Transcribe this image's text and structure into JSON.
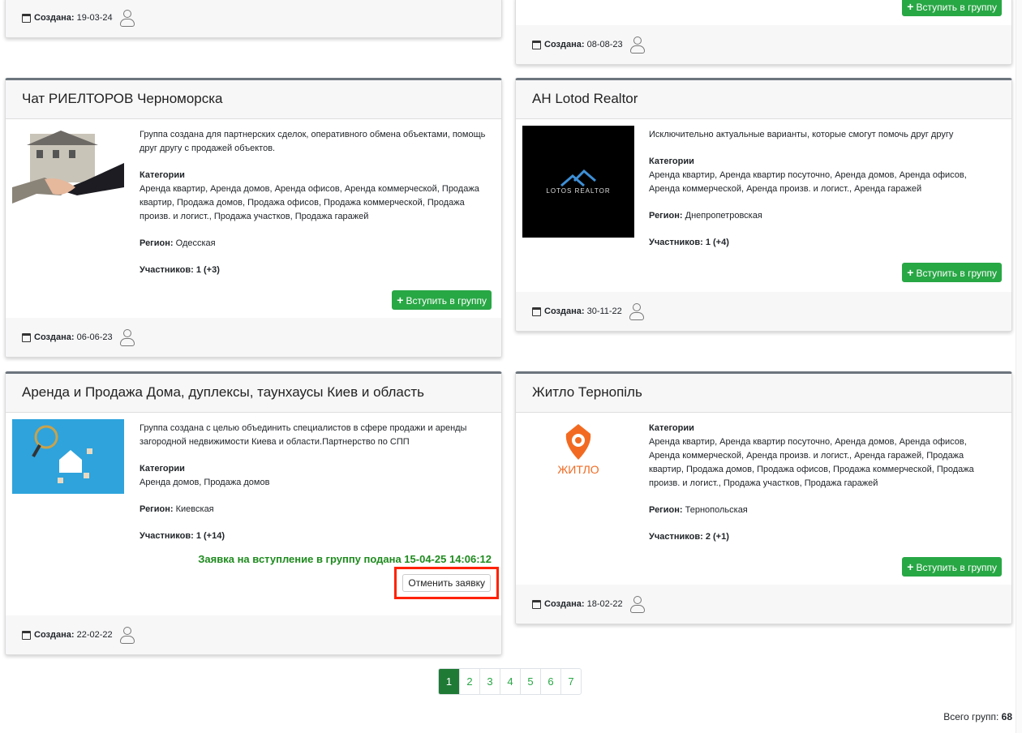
{
  "labels": {
    "categories": "Категории",
    "region": "Регион:",
    "members": "Участников:",
    "created": "Создана:",
    "join": "Вступить в группу",
    "join_plus": "+",
    "cancel": "Отменить заявку",
    "total_label": "Всего групп:"
  },
  "top_partial": {
    "left_created": "19-03-24",
    "right_created": "08-08-23"
  },
  "cards": [
    {
      "title": "Чат РИЕЛТОРОВ Черноморска",
      "description": "Группа создана для партнерских сделок, оперативного обмена объектами, помощь друг другу с продажей объектов.",
      "categories": "Аренда квартир, Аренда домов, Аренда офисов, Аренда коммерческой, Продажа квартир, Продажа домов, Продажа офисов, Продажа коммерческой, Продажа произв. и логист., Продажа участков, Продажа гаражей",
      "region": "Одесская",
      "members": "1 (+3)",
      "created": "06-06-23"
    },
    {
      "title": "АН Lotod Realtor",
      "description": "Исключительно актуальные варианты, которые смогут помочь друг другу",
      "categories": "Аренда квартир, Аренда квартир посуточно, Аренда домов, Аренда офисов, Аренда коммерческой, Аренда произв. и логист., Аренда гаражей",
      "region": "Днепропетровская",
      "members": "1 (+4)",
      "created": "30-11-22",
      "logo_text": "LOTOS REALTOR"
    },
    {
      "title": "Аренда и Продажа Дома, дуплексы, таунхаусы Киев и область",
      "description": "Группа создана с целью объединить специалистов в сфере продажи и аренды загородной недвижимости Киева и области.Партнерство по СПП",
      "categories": "Аренда домов, Продажа домов",
      "region": "Киевская",
      "members": "1 (+14)",
      "created": "22-02-22",
      "status": "Заявка на вступление в группу подана 15-04-25 14:06:12"
    },
    {
      "title": "Житло Тернопіль",
      "categories": "Аренда квартир, Аренда квартир посуточно, Аренда домов, Аренда офисов, Аренда коммерческой, Аренда произв. и логист., Аренда гаражей, Продажа квартир, Продажа домов, Продажа офисов, Продажа коммерческой, Продажа произв. и логист., Продажа участков, Продажа гаражей",
      "region": "Тернопольская",
      "members": "2 (+1)",
      "created": "18-02-22",
      "logo_text": "ЖИТЛО"
    }
  ],
  "pagination": {
    "pages": [
      "1",
      "2",
      "3",
      "4",
      "5",
      "6",
      "7"
    ],
    "current": "1"
  },
  "total": "68",
  "colors": {
    "accent": "#28a745",
    "highlight": "#ff2200"
  }
}
